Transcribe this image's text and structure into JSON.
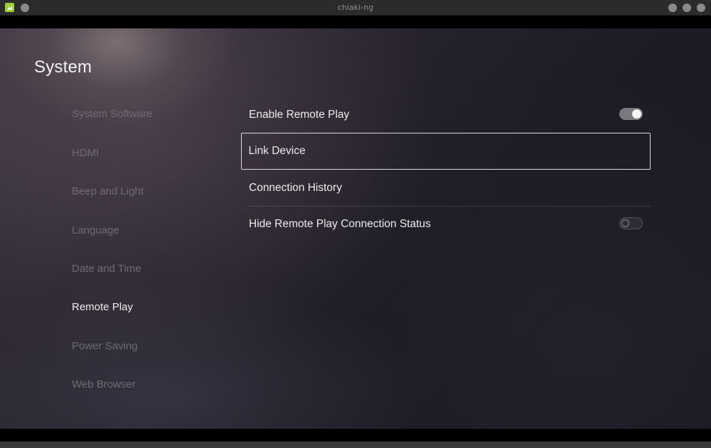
{
  "window": {
    "title": "chiaki-ng",
    "icon": "chiaki-app-icon"
  },
  "page": {
    "title": "System"
  },
  "sidebar": {
    "items": [
      {
        "label": "System Software",
        "active": false
      },
      {
        "label": "HDMI",
        "active": false
      },
      {
        "label": "Beep and Light",
        "active": false
      },
      {
        "label": "Language",
        "active": false
      },
      {
        "label": "Date and Time",
        "active": false
      },
      {
        "label": "Remote Play",
        "active": true
      },
      {
        "label": "Power Saving",
        "active": false
      },
      {
        "label": "Web Browser",
        "active": false
      }
    ]
  },
  "settings": {
    "rows": [
      {
        "label": "Enable Remote Play",
        "control": "toggle",
        "state": "on"
      },
      {
        "label": "Link Device",
        "control": "none",
        "focused": true
      },
      {
        "label": "Connection History",
        "control": "none"
      },
      {
        "label": "Hide Remote Play Connection Status",
        "control": "toggle",
        "state": "off"
      }
    ]
  },
  "colors": {
    "toggle_on_track": "#7a797f",
    "focus_border": "#dcdcdc",
    "active_text": "#ededed",
    "inactive_text": "#6e6b73"
  }
}
